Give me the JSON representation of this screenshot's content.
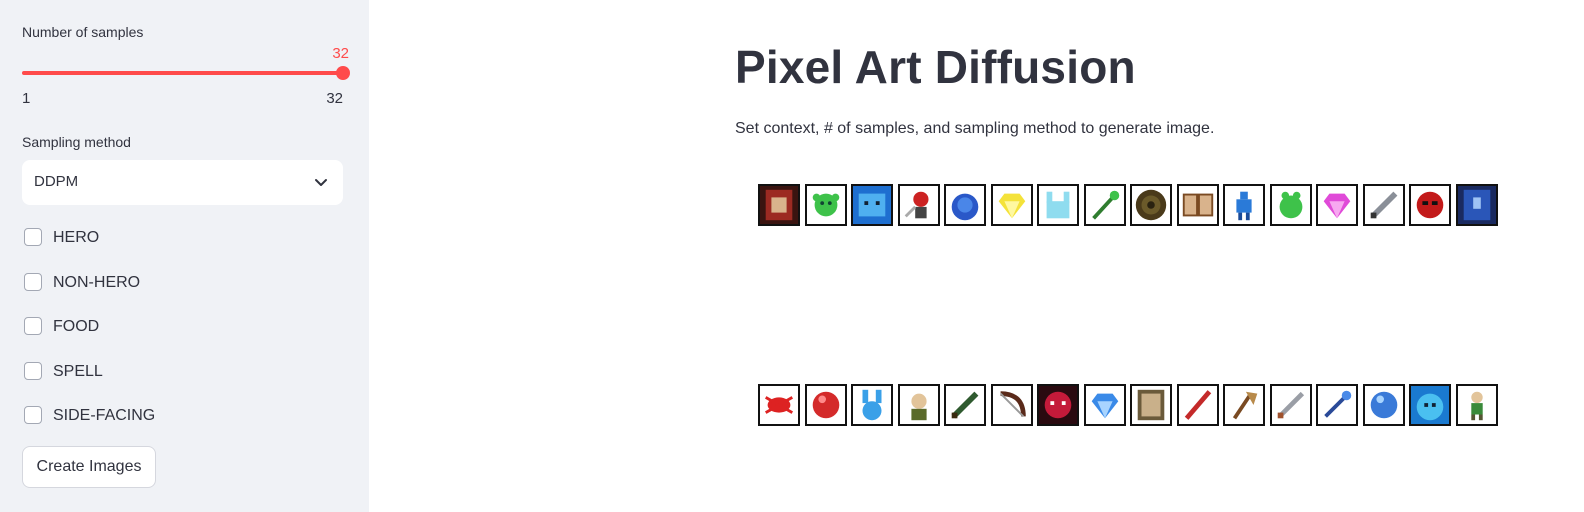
{
  "sidebar": {
    "samples": {
      "label": "Number of samples",
      "value": "32",
      "min": "1",
      "max": "32"
    },
    "sampling": {
      "label": "Sampling method",
      "selected": "DDPM"
    },
    "checkboxes": [
      {
        "label": "HERO",
        "checked": false
      },
      {
        "label": "NON-HERO",
        "checked": false
      },
      {
        "label": "FOOD",
        "checked": false
      },
      {
        "label": "SPELL",
        "checked": false
      },
      {
        "label": "SIDE-FACING",
        "checked": false
      }
    ],
    "create_button": "Create Images"
  },
  "main": {
    "title": "Pixel Art Diffusion",
    "subtitle": "Set context, # of samples, and sampling method to generate image."
  },
  "colors": {
    "accent": "#ff4b4b",
    "sidebar_bg": "#f0f2f6",
    "text": "#31333f"
  },
  "icons": {
    "row1": [
      "book-icon",
      "slime-icon",
      "water-creature-icon",
      "warrior-icon",
      "blue-blob-icon",
      "yellow-gem-icon",
      "ghost-bunny-icon",
      "staff-icon",
      "shield-icon",
      "open-book-icon",
      "blue-hero-icon",
      "frog-icon",
      "pink-gem-icon",
      "sword-icon",
      "red-mask-icon",
      "blue-book-icon"
    ],
    "row2": [
      "red-bug-icon",
      "red-orb-icon",
      "blue-bunny-icon",
      "bald-hero-icon",
      "wooden-sword-icon",
      "bow-icon",
      "dark-monster-icon",
      "blue-gem-icon",
      "tome-icon",
      "red-staff-icon",
      "axe-icon",
      "dagger-icon",
      "blue-wand-icon",
      "blue-orb-icon",
      "blue-slime-icon",
      "green-hero-icon"
    ]
  }
}
